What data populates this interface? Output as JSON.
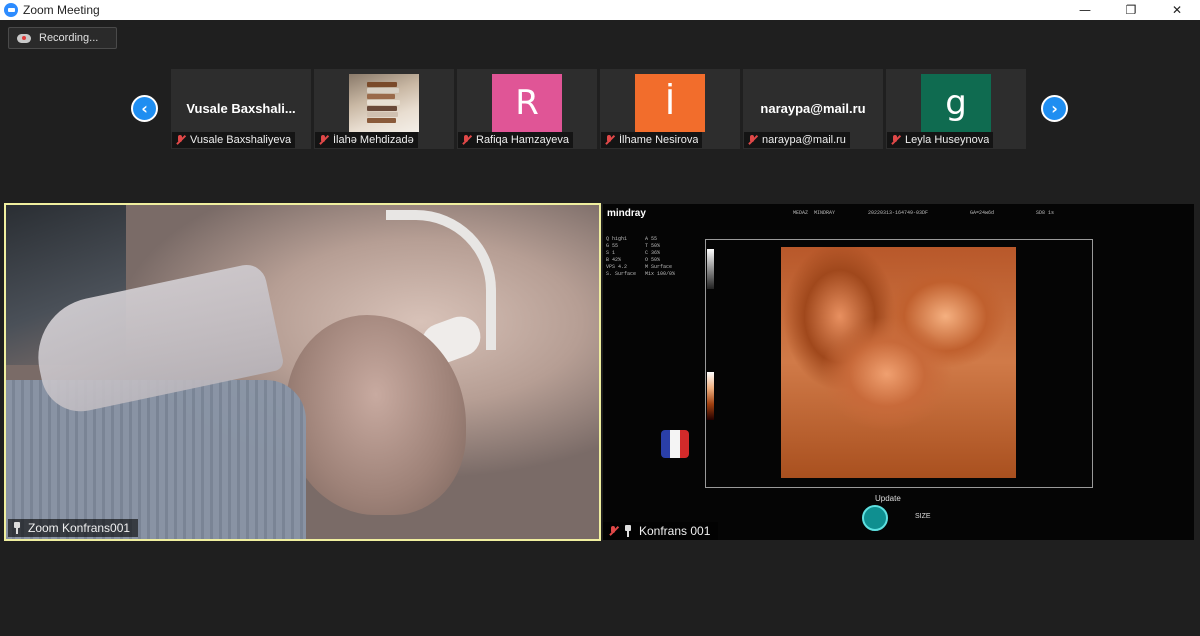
{
  "window": {
    "title": "Zoom Meeting",
    "minimize": "—",
    "restore": "❐",
    "close": "✕"
  },
  "recording": {
    "label": "Recording..."
  },
  "gallery": {
    "prev": "‹",
    "next": "›",
    "participants": [
      {
        "name": "Vusale Baxshaliyeva",
        "display": "Vusale  Baxshali...",
        "type": "text"
      },
      {
        "name": "İlahə Mehdizadə",
        "type": "photo"
      },
      {
        "name": "Rafiqa Hamzayeva",
        "initial": "R",
        "color": "#e05596",
        "type": "initial"
      },
      {
        "name": "İlhame Nesirova",
        "initial": "İ",
        "color": "#f26d2c",
        "type": "initial"
      },
      {
        "name": "naraypa@mail.ru",
        "display": "naraypa@mail.ru",
        "type": "text"
      },
      {
        "name": "Leyla Huseynova",
        "initial": "g",
        "color": "#0f6b50",
        "type": "initial"
      }
    ]
  },
  "main_videos": {
    "left_label": "Zoom Konfrans001",
    "right_label": "Konfrans 001",
    "active_border_color": "#f0ef9f"
  },
  "ultrasound": {
    "brand": "mindray",
    "update": "Update",
    "size": "SIZE"
  }
}
